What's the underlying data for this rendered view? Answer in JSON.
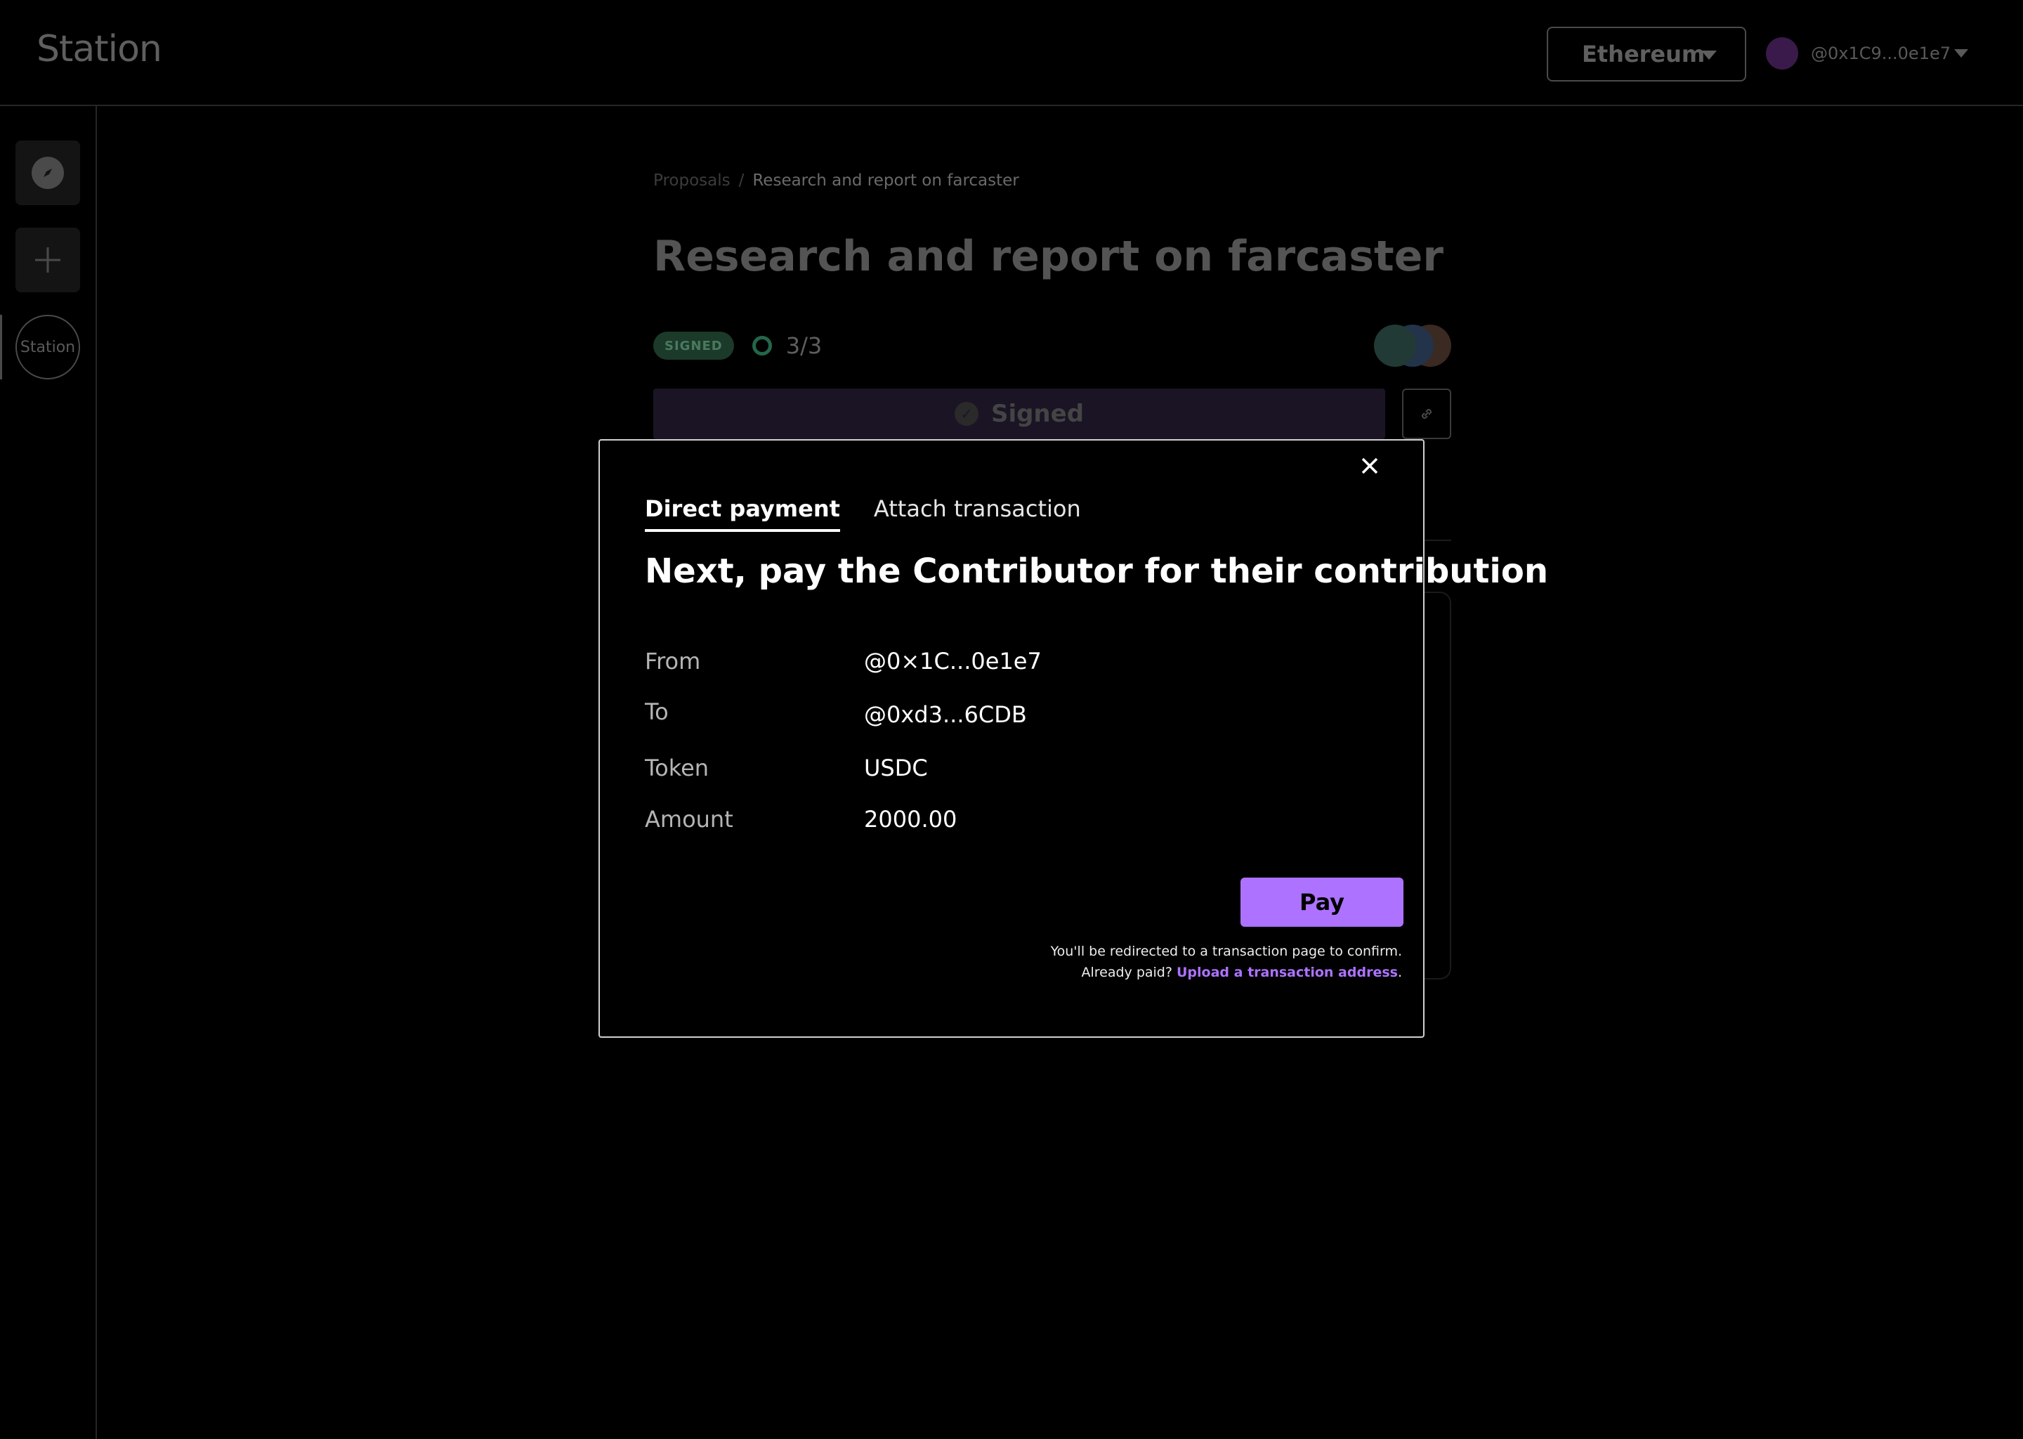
{
  "header": {
    "logo": "Station",
    "network": "Ethereum",
    "account_address": "@0x1C9...0e1e7"
  },
  "sidebar": {
    "station_label": "Station"
  },
  "page": {
    "breadcrumb": [
      "Proposals",
      "Research and report on farcaster"
    ],
    "breadcrumb_separator": "/",
    "title": "Research and report on farcaster",
    "status_badge": "SIGNED",
    "signatures": "3/3",
    "signed_label": "Signed"
  },
  "modal": {
    "tabs": [
      "Direct payment",
      "Attach transaction"
    ],
    "active_tab": "Direct payment",
    "title": "Next, pay the Contributor for their contribution",
    "fields": [
      {
        "label": "From",
        "value": "@0×1C...0e1e7"
      },
      {
        "label": "To",
        "value": "@0xd3...6CDB"
      },
      {
        "label": "Token",
        "value": "USDC"
      },
      {
        "label": "Amount",
        "value": "2000.00"
      }
    ],
    "pay_label": "Pay",
    "note_line1": "You'll be redirected to a transaction page to confirm.",
    "note_prefix": "Already paid?",
    "note_link": "Upload a transaction address",
    "note_suffix": "."
  },
  "colors": {
    "accent": "#ad72ff",
    "background": "#000000",
    "signed_badge": "#1b3a2a",
    "signature_ring": "#24664a"
  }
}
